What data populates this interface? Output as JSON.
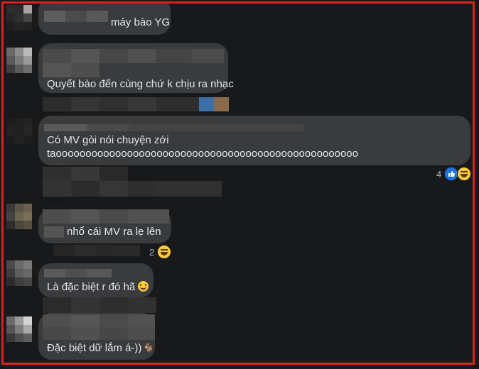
{
  "comments": [
    {
      "id": "c1",
      "text": "máy bào YG"
    },
    {
      "id": "c2",
      "text": "Quyết bào đến cùng chứ k chịu ra nhạc"
    },
    {
      "id": "c3",
      "lines": [
        "Có MV gòi nói chuyện zới",
        "taooooooooooooooooooooooooooooooooooooooooooooooooooo"
      ],
      "reaction_count": "4",
      "reactions": [
        "like-icon",
        "haha-icon"
      ]
    },
    {
      "id": "c4",
      "text": "nhổ cái MV ra lẹ lên",
      "reaction_count": "2",
      "reactions": [
        "haha-icon"
      ]
    },
    {
      "id": "c5",
      "text": "Là đặc biệt r đó hã",
      "emoji": "slightly-smiling-face"
    },
    {
      "id": "c6",
      "text": "Đặc biệt dữ lắm á-))",
      "emoji": "goat-icon"
    }
  ],
  "colors": {
    "background": "#18191a",
    "bubble": "#3a3b3c",
    "text": "#e4e6eb",
    "frame": "#e0201b",
    "like": "#1b74e4",
    "haha": "#f7c93c"
  }
}
